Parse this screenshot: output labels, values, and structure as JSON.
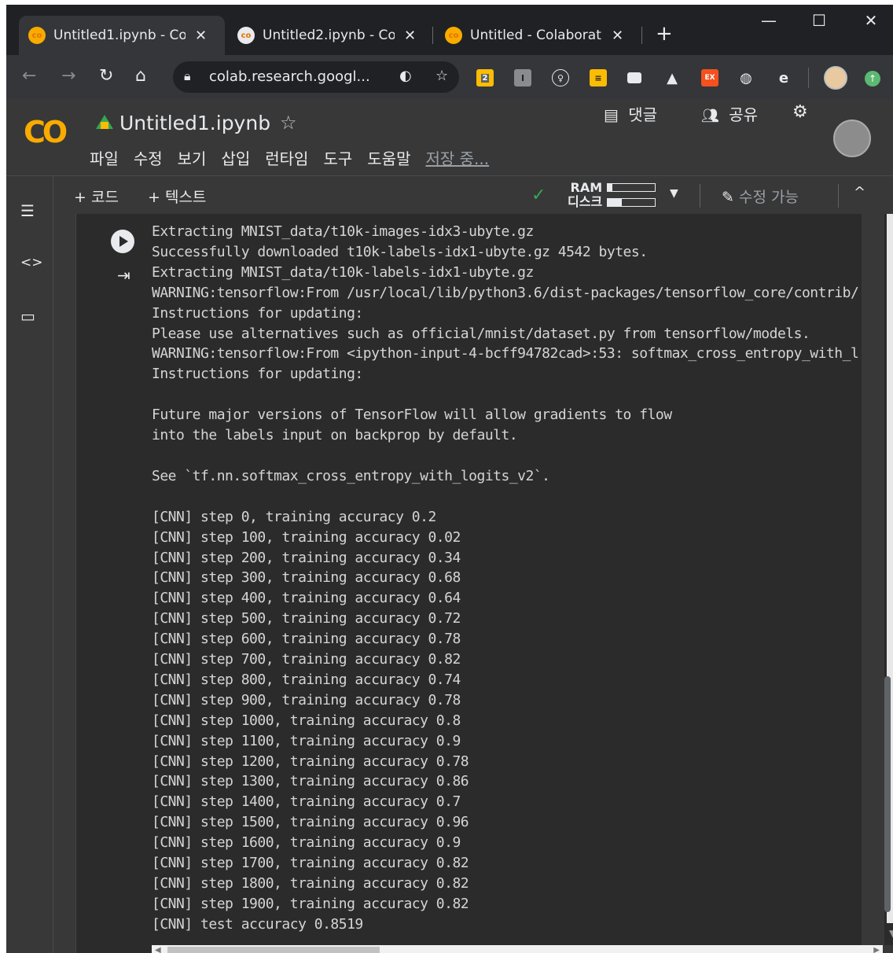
{
  "browser": {
    "tabs": [
      {
        "title": "Untitled1.ipynb - Col",
        "close": "✕",
        "icon": "colab-icon"
      },
      {
        "title": "Untitled2.ipynb - Col",
        "close": "✕",
        "icon": "colab-icon"
      },
      {
        "title": "Untitled - Colaborat",
        "close": "✕",
        "icon": "colab-icon"
      }
    ],
    "new_tab": "+",
    "window_controls": {
      "minimize": "—",
      "maximize": "☐",
      "close": "✕"
    },
    "url": "colab.research.googl...",
    "extension_badge": "2",
    "extension_ex_label": "EX"
  },
  "colab": {
    "logo": "CO",
    "notebook_name": "Untitled1.ipynb",
    "menu": [
      "파일",
      "수정",
      "보기",
      "삽입",
      "런타임",
      "도구",
      "도움말"
    ],
    "saving_status": "저장 중...",
    "comment_label": "댓글",
    "share_label": "공유",
    "toolbar": {
      "add_code": "+ 코드",
      "add_text": "+ 텍스트",
      "ram_label": "RAM",
      "disk_label": "디스크",
      "ram_usage_fraction": 0.1,
      "disk_usage_fraction": 0.3,
      "editable_label": "수정 가능"
    }
  },
  "output_lines": [
    "Extracting MNIST_data/t10k-images-idx3-ubyte.gz",
    "Successfully downloaded t10k-labels-idx1-ubyte.gz 4542 bytes.",
    "Extracting MNIST_data/t10k-labels-idx1-ubyte.gz",
    "WARNING:tensorflow:From /usr/local/lib/python3.6/dist-packages/tensorflow_core/contrib/",
    "Instructions for updating:",
    "Please use alternatives such as official/mnist/dataset.py from tensorflow/models.",
    "WARNING:tensorflow:From <ipython-input-4-bcff94782cad>:53: softmax_cross_entropy_with_l",
    "Instructions for updating:",
    "",
    "Future major versions of TensorFlow will allow gradients to flow",
    "into the labels input on backprop by default.",
    "",
    "See `tf.nn.softmax_cross_entropy_with_logits_v2`.",
    "",
    "[CNN] step 0, training accuracy 0.2",
    "[CNN] step 100, training accuracy 0.02",
    "[CNN] step 200, training accuracy 0.34",
    "[CNN] step 300, training accuracy 0.68",
    "[CNN] step 400, training accuracy 0.64",
    "[CNN] step 500, training accuracy 0.72",
    "[CNN] step 600, training accuracy 0.78",
    "[CNN] step 700, training accuracy 0.82",
    "[CNN] step 800, training accuracy 0.74",
    "[CNN] step 900, training accuracy 0.78",
    "[CNN] step 1000, training accuracy 0.8",
    "[CNN] step 1100, training accuracy 0.9",
    "[CNN] step 1200, training accuracy 0.78",
    "[CNN] step 1300, training accuracy 0.86",
    "[CNN] step 1400, training accuracy 0.7",
    "[CNN] step 1500, training accuracy 0.96",
    "[CNN] step 1600, training accuracy 0.9",
    "[CNN] step 1700, training accuracy 0.82",
    "[CNN] step 1800, training accuracy 0.82",
    "[CNN] step 1900, training accuracy 0.82",
    "[CNN] test accuracy 0.8519"
  ]
}
